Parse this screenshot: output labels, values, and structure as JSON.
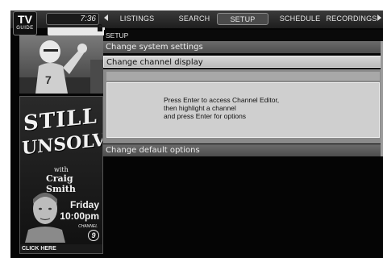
{
  "logo": {
    "line1": "TV",
    "line2": "GUIDE"
  },
  "clock": "7:36",
  "nav": {
    "prev_arrow": "arrow-left",
    "next_arrow": "arrow-right",
    "tabs": [
      {
        "label": "LISTINGS"
      },
      {
        "label": "SEARCH"
      },
      {
        "label": "SETUP",
        "selected": true
      },
      {
        "label": "SCHEDULE"
      },
      {
        "label": "RECORDINGS"
      }
    ]
  },
  "panel": {
    "title": "SETUP",
    "items": [
      {
        "label": "Change system settings"
      },
      {
        "label": "Change channel display",
        "selected": true
      },
      {
        "label": "Change default options"
      }
    ],
    "description": [
      "Press Enter to access Channel Editor,",
      "then highlight a channel",
      "and press Enter for options"
    ]
  },
  "ad": {
    "title_line1": "STILL",
    "title_line2": "UNSOLVED",
    "with": "with",
    "host": "Craig Smith",
    "day": "Friday",
    "time": "10:00pm",
    "channel_label": "CHANNEL",
    "channel_number": "9",
    "cta": "CLICK HERE"
  },
  "colors": {
    "background": "#050505",
    "selected_row": "#c8c8c8",
    "row": "#5c5c5c",
    "text_light": "#ececec"
  }
}
